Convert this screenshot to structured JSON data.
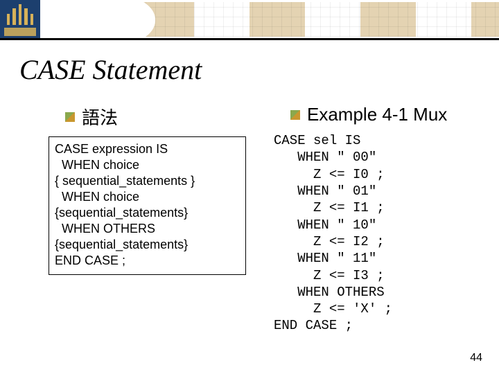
{
  "title": "CASE Statement",
  "left": {
    "heading": "語法",
    "syntax_lines": [
      "CASE expression IS",
      "  WHEN choice",
      "{ sequential_statements }",
      "  WHEN choice",
      "{sequential_statements}",
      "  WHEN OTHERS",
      "{sequential_statements}",
      "END CASE ;"
    ]
  },
  "right": {
    "heading": "Example 4-1 Mux",
    "code_lines": [
      "CASE sel IS",
      "   WHEN \" 00\"",
      "     Z <= I0 ;",
      "   WHEN \" 01\"",
      "     Z <= I1 ;",
      "   WHEN \" 10\"",
      "     Z <= I2 ;",
      "   WHEN \" 11\"",
      "     Z <= I3 ;",
      "   WHEN OTHERS",
      "     Z <= 'X' ;",
      "END CASE ;"
    ]
  },
  "page_number": "44"
}
